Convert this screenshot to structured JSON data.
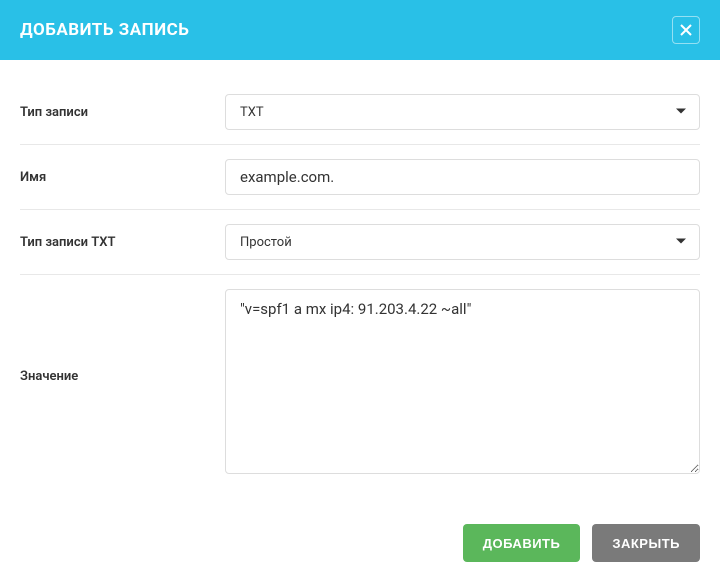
{
  "modal": {
    "title": "ДОБАВИТЬ ЗАПИСЬ"
  },
  "form": {
    "record_type": {
      "label": "Тип записи",
      "value": "TXT"
    },
    "name": {
      "label": "Имя",
      "value": "example.com."
    },
    "txt_type": {
      "label": "Тип записи TXT",
      "value": "Простой"
    },
    "value": {
      "label": "Значение",
      "value": "\"v=spf1 a mx ip4: 91.203.4.22 ~all\""
    }
  },
  "buttons": {
    "add": "ДОБАВИТЬ",
    "close": "ЗАКРЫТЬ"
  }
}
